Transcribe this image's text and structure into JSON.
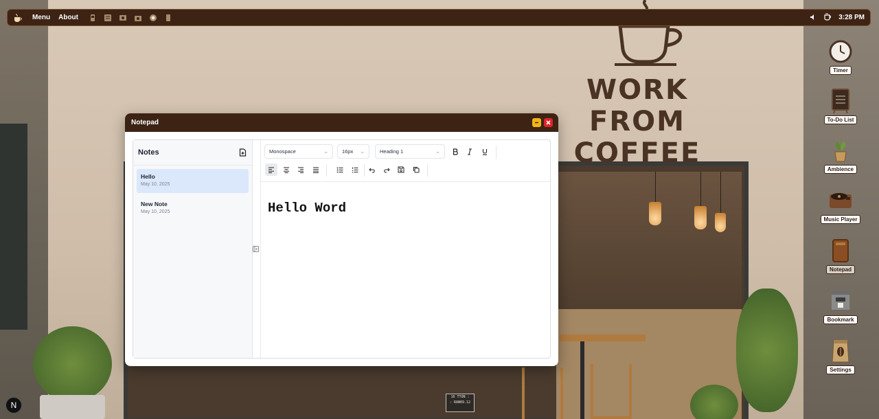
{
  "topbar": {
    "menu_label": "Menu",
    "about_label": "About",
    "apps": [
      "timer-icon",
      "todo-icon",
      "ambience-icon",
      "music-player-icon",
      "notepad-icon",
      "bookmark-icon"
    ],
    "time": "3:28 PM"
  },
  "background": {
    "sign_line1": "WORK FROM",
    "sign_line2": "COFFEE",
    "door_sign_line1": "16 TTON :",
    "door_sign_line2": ": RAN09.12"
  },
  "desktop_icons": [
    {
      "label": "Timer",
      "icon": "clock-icon"
    },
    {
      "label": "To-Do List",
      "icon": "menu-board-icon"
    },
    {
      "label": "Ambience",
      "icon": "plant-icon"
    },
    {
      "label": "Music Player",
      "icon": "record-player-icon"
    },
    {
      "label": "Notepad",
      "icon": "notebook-icon"
    },
    {
      "label": "Bookmark",
      "icon": "espresso-machine-icon"
    },
    {
      "label": "Settings",
      "icon": "coffee-bag-icon"
    }
  ],
  "window": {
    "title": "Notepad",
    "sidebar_title": "Notes",
    "notes": [
      {
        "title": "Hello",
        "date": "May 10, 2025",
        "selected": true
      },
      {
        "title": "New Note",
        "date": "May 10, 2025",
        "selected": false
      }
    ],
    "toolbar": {
      "font_family": "Monospace",
      "font_size": "16px",
      "block_style": "Heading 1"
    },
    "content": "Hello Word"
  },
  "bubble_letter": "N",
  "colors": {
    "bar": "#3d2314",
    "accent_selected": "#dbe8fb",
    "minimize": "#f2b417",
    "close": "#e0242a"
  }
}
